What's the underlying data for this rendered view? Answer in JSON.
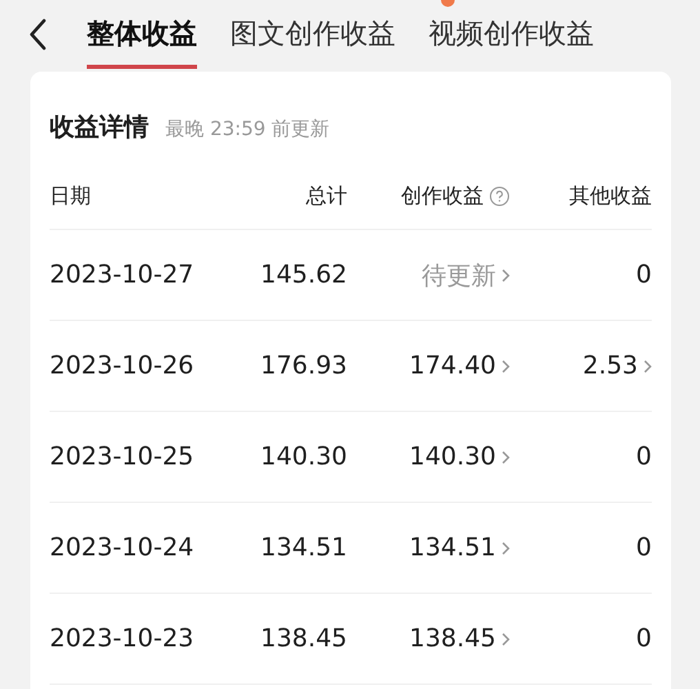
{
  "tabs": [
    {
      "label": "整体收益",
      "selected": true
    },
    {
      "label": "图文创作收益",
      "selected": false
    },
    {
      "label": "视频创作收益",
      "selected": false
    }
  ],
  "card": {
    "title": "收益详情",
    "subtitle": "最晚 23:59 前更新"
  },
  "table": {
    "columns": [
      "日期",
      "总计",
      "创作收益",
      "其他收益"
    ],
    "rows": [
      {
        "date": "2023-10-27",
        "total": "145.62",
        "creative": {
          "value": "待更新",
          "pending": true,
          "link": true
        },
        "other": {
          "value": "0",
          "pending": false,
          "link": false
        }
      },
      {
        "date": "2023-10-26",
        "total": "176.93",
        "creative": {
          "value": "174.40",
          "pending": false,
          "link": true
        },
        "other": {
          "value": "2.53",
          "pending": false,
          "link": true
        }
      },
      {
        "date": "2023-10-25",
        "total": "140.30",
        "creative": {
          "value": "140.30",
          "pending": false,
          "link": true
        },
        "other": {
          "value": "0",
          "pending": false,
          "link": false
        }
      },
      {
        "date": "2023-10-24",
        "total": "134.51",
        "creative": {
          "value": "134.51",
          "pending": false,
          "link": true
        },
        "other": {
          "value": "0",
          "pending": false,
          "link": false
        }
      },
      {
        "date": "2023-10-23",
        "total": "138.45",
        "creative": {
          "value": "138.45",
          "pending": false,
          "link": true
        },
        "other": {
          "value": "0",
          "pending": false,
          "link": false
        }
      }
    ]
  }
}
